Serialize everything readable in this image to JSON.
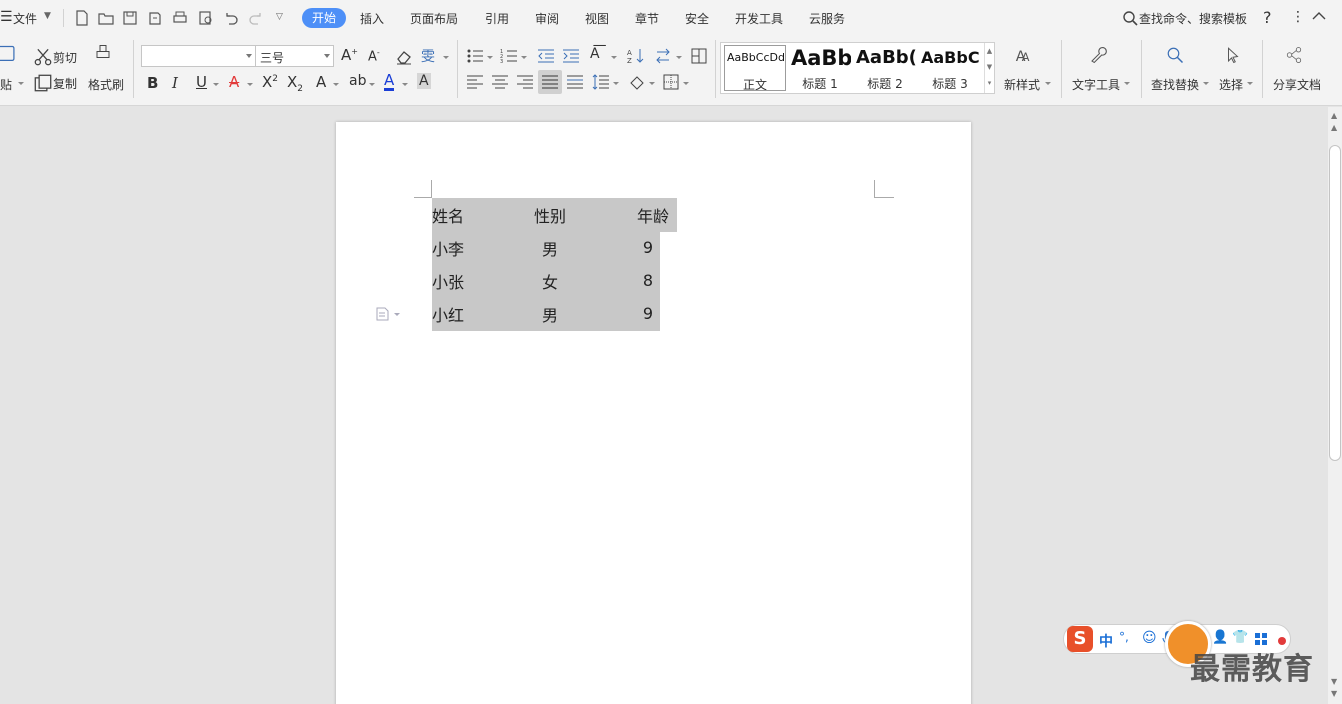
{
  "menu": {
    "file_label": "文件",
    "tabs": [
      "开始",
      "插入",
      "页面布局",
      "引用",
      "审阅",
      "视图",
      "章节",
      "安全",
      "开发工具",
      "云服务"
    ],
    "active_tab": "开始",
    "search_label": "查找命令、搜索模板",
    "help_label": "?",
    "more_label": "⋮"
  },
  "ribbon": {
    "paste_label": "贴",
    "cut_label": "剪切",
    "copy_label": "复制",
    "format_painter_label": "格式刷",
    "font_name": "",
    "font_size": "三号",
    "styles": [
      {
        "preview": "AaBbCcDd",
        "name": "正文"
      },
      {
        "preview": "AaBb",
        "name": "标题 1"
      },
      {
        "preview": "AaBb(",
        "name": "标题 2"
      },
      {
        "preview": "AaBbC",
        "name": "标题 3"
      }
    ],
    "new_style_label": "新样式",
    "text_tools_label": "文字工具",
    "find_replace_label": "查找替换",
    "select_label": "选择",
    "share_label": "分享文档",
    "colors": {
      "accent": "#4d8ff7",
      "font_color": "#1a3ed6",
      "highlight": "#e23b3b"
    }
  },
  "document": {
    "table": {
      "headers": [
        "姓名",
        "性别",
        "年龄"
      ],
      "rows": [
        [
          "小李",
          "男",
          "9"
        ],
        [
          "小张",
          "女",
          "8"
        ],
        [
          "小红",
          "男",
          "9"
        ]
      ]
    }
  },
  "ime": {
    "mode_label": "中",
    "punct_label": "°,"
  },
  "watermark": "最需教育"
}
